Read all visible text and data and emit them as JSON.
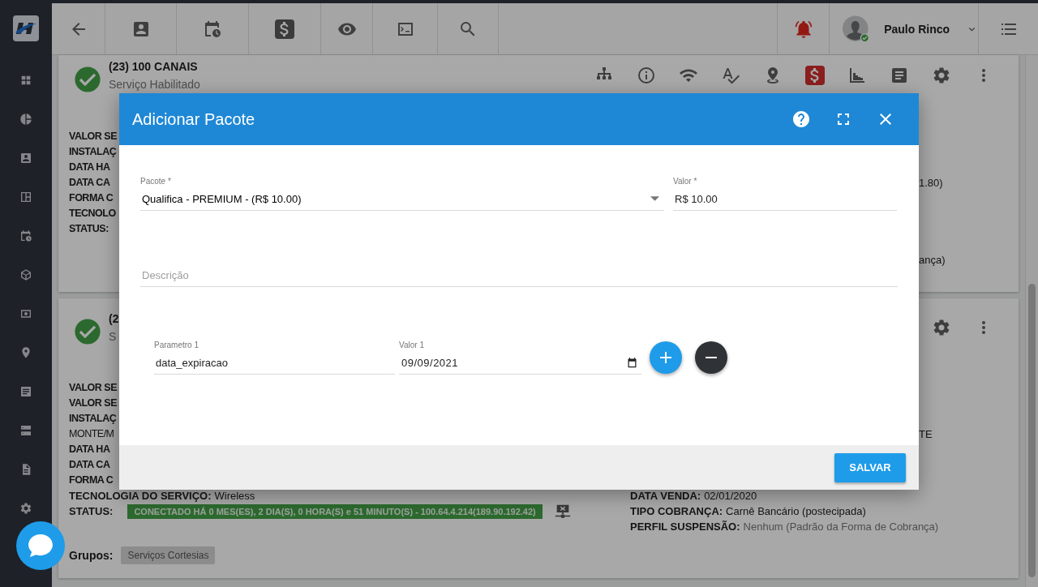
{
  "topbar": {
    "user_name": "Paulo Rinco"
  },
  "services": [
    {
      "title": "(23) 100 CANAIS",
      "subtitle": "Serviço Habilitado",
      "rows": [
        {
          "left": {
            "kind": "fragment",
            "text": "VALOR SE",
            "bold": true
          }
        },
        {
          "left": {
            "kind": "fragment",
            "text": "INSTALAÇ",
            "bold": true
          }
        },
        {
          "left": {
            "kind": "fragment",
            "text": "DATA HA",
            "bold": true
          }
        },
        {
          "left": {
            "kind": "fragment",
            "text": "DATA CA",
            "bold": true
          },
          "right": {
            "kind": "fragment",
            "text": "1.80)",
            "bold": false
          }
        },
        {
          "left": {
            "kind": "fragment",
            "text": "FORMA C",
            "bold": true
          }
        },
        {
          "left": {
            "kind": "fragment",
            "text": "TECNOLO",
            "bold": true
          }
        },
        {
          "left": {
            "kind": "fragment",
            "text": "STATUS:",
            "bold": true
          }
        },
        {
          "right": {
            "kind": "fragment",
            "text": "ança)",
            "bold": false
          }
        }
      ]
    },
    {
      "title": "(2",
      "subtitle": "S",
      "rows": [
        {
          "left": {
            "kind": "fragment",
            "text": "VALOR SE",
            "bold": true
          }
        },
        {
          "left": {
            "kind": "fragment",
            "text": "VALOR SE",
            "bold": true
          }
        },
        {
          "left": {
            "kind": "fragment",
            "text": "INSTALAÇ",
            "bold": true
          }
        },
        {
          "left": {
            "kind": "fragment",
            "text": "MONTE/M",
            "bold": false
          },
          "right": {
            "kind": "fragment",
            "text": "TE",
            "bold": false
          }
        },
        {
          "left": {
            "kind": "fragment",
            "text": "DATA HA",
            "bold": true
          }
        },
        {
          "left": {
            "kind": "fragment",
            "text": "DATA CA",
            "bold": true
          }
        },
        {
          "left": {
            "kind": "fragment",
            "text": "FORMA C",
            "bold": true
          }
        },
        {
          "left": {
            "kind": "field",
            "label": "TECNOLOGIA DO SERVIÇO:",
            "value": "Wireless",
            "muted": false
          },
          "right": {
            "kind": "field",
            "label": "DATA VENDA:",
            "value": "02/01/2020",
            "muted": false
          }
        },
        {
          "left": {
            "kind": "status",
            "label": "STATUS:",
            "badge": "CONECTADO HÁ 0 MES(ES), 2 DIA(S), 0 HORA(S) e 51 MINUTO(S) - 100.64.4.214(189.90.192.42)"
          },
          "right": {
            "kind": "field",
            "label": "TIPO COBRANÇA:",
            "value": "Carnê Bancário (postecipada)",
            "muted": false
          }
        },
        {
          "right": {
            "kind": "field",
            "label": "PERFIL SUSPENSÃO:",
            "value": "Nenhum (Padrão da Forma de Cobrança)",
            "muted": true
          }
        }
      ],
      "groups": {
        "label": "Grupos:",
        "tags": [
          "Serviços Cortesias"
        ]
      }
    }
  ],
  "dialog": {
    "title": "Adicionar Pacote",
    "package": {
      "label": "Pacote *",
      "value": "Qualifica - PREMIUM - (R$ 10.00)"
    },
    "price": {
      "label": "Valor *",
      "value": "R$ 10.00"
    },
    "description": {
      "placeholder": "Descrição"
    },
    "parameters": [
      {
        "name_label": "Parametro 1",
        "name": "data_expiracao",
        "value_label": "Valor 1",
        "value": "09/09/2021"
      }
    ],
    "save_button": "SALVAR"
  }
}
